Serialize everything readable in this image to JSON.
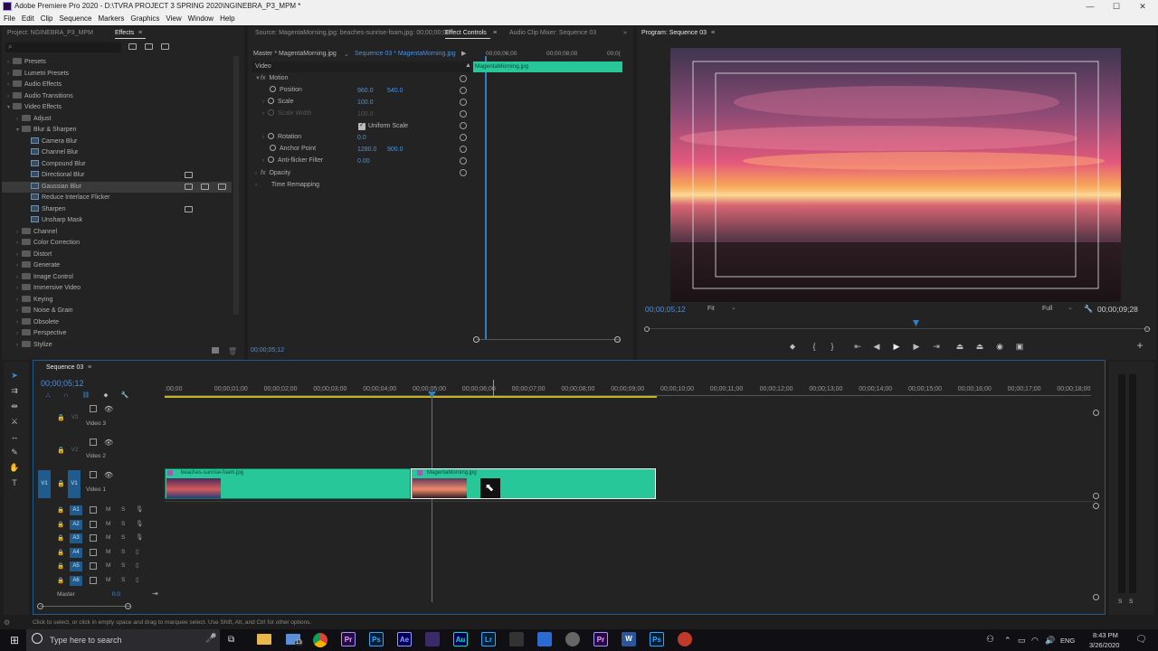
{
  "window": {
    "title": "Adobe Premiere Pro 2020 - D:\\TVRA PROJECT 3 SPRING 2020\\NGINEBRA_P3_MPM *",
    "minimize": "—",
    "maximize": "☐",
    "close": "✕"
  },
  "menu": [
    "File",
    "Edit",
    "Clip",
    "Sequence",
    "Markers",
    "Graphics",
    "View",
    "Window",
    "Help"
  ],
  "left_panel": {
    "tabs": [
      "Project: NGINEBRA_P3_MPM",
      "Effects"
    ],
    "search_placeholder": "",
    "tree": [
      {
        "label": "Presets",
        "level": 0,
        "type": "folder",
        "open": false
      },
      {
        "label": "Lumetri Presets",
        "level": 0,
        "type": "folder",
        "open": false
      },
      {
        "label": "Audio Effects",
        "level": 0,
        "type": "folder",
        "open": false
      },
      {
        "label": "Audio Transitions",
        "level": 0,
        "type": "folder",
        "open": false
      },
      {
        "label": "Video Effects",
        "level": 0,
        "type": "folder",
        "open": true
      },
      {
        "label": "Adjust",
        "level": 1,
        "type": "folder",
        "open": false
      },
      {
        "label": "Blur & Sharpen",
        "level": 1,
        "type": "folder",
        "open": true
      },
      {
        "label": "Camera Blur",
        "level": 2,
        "type": "fx"
      },
      {
        "label": "Channel Blur",
        "level": 2,
        "type": "fx"
      },
      {
        "label": "Compound Blur",
        "level": 2,
        "type": "fx"
      },
      {
        "label": "Directional Blur",
        "level": 2,
        "type": "fx"
      },
      {
        "label": "Gaussian Blur",
        "level": 2,
        "type": "fx",
        "selected": true
      },
      {
        "label": "Reduce Interlace Flicker",
        "level": 2,
        "type": "fx"
      },
      {
        "label": "Sharpen",
        "level": 2,
        "type": "fx"
      },
      {
        "label": "Unsharp Mask",
        "level": 2,
        "type": "fx"
      },
      {
        "label": "Channel",
        "level": 1,
        "type": "folder",
        "open": false
      },
      {
        "label": "Color Correction",
        "level": 1,
        "type": "folder",
        "open": false
      },
      {
        "label": "Distort",
        "level": 1,
        "type": "folder",
        "open": false
      },
      {
        "label": "Generate",
        "level": 1,
        "type": "folder",
        "open": false
      },
      {
        "label": "Image Control",
        "level": 1,
        "type": "folder",
        "open": false
      },
      {
        "label": "Immersive Video",
        "level": 1,
        "type": "folder",
        "open": false
      },
      {
        "label": "Keying",
        "level": 1,
        "type": "folder",
        "open": false
      },
      {
        "label": "Noise & Grain",
        "level": 1,
        "type": "folder",
        "open": false
      },
      {
        "label": "Obsolete",
        "level": 1,
        "type": "folder",
        "open": false
      },
      {
        "label": "Perspective",
        "level": 1,
        "type": "folder",
        "open": false
      },
      {
        "label": "Stylize",
        "level": 1,
        "type": "folder",
        "open": false
      }
    ]
  },
  "effect_controls": {
    "tabs": [
      "Source: MagentaMorning.jpg: beaches-sunrise-foam.jpg: 00;00;00;00",
      "Effect Controls",
      "Audio Clip Mixer: Sequence 03"
    ],
    "master_label": "Master * MagentaMorning.jpg",
    "seq_label": "Sequence 03 * MagentaMorning.jpg",
    "section_video": "Video",
    "motion": "Motion",
    "position_label": "Position",
    "position_x": "960.0",
    "position_y": "540.0",
    "scale_label": "Scale",
    "scale_value": "100.0",
    "scale_width_label": "Scale Width",
    "scale_width_value": "100.0",
    "uniform_scale": "Uniform Scale",
    "rotation_label": "Rotation",
    "rotation_value": "0.0",
    "anchor_label": "Anchor Point",
    "anchor_x": "1280.0",
    "anchor_y": "900.0",
    "antiflicker_label": "Anti-flicker Filter",
    "antiflicker_value": "0.00",
    "opacity": "Opacity",
    "time_remap": "Time Remapping",
    "timecode": "00;00;05;12",
    "mini_ruler": [
      "00;00;06;00",
      "00;00;08;00",
      "00;0("
    ],
    "clip_label": "MagentaMorning.jpg"
  },
  "program": {
    "tab": "Program: Sequence 03",
    "timecode": "00;00;05;12",
    "fit": "Fit",
    "full": "Full",
    "duration": "00;00;09;28"
  },
  "timeline": {
    "tab": "Sequence 03",
    "timecode": "00;00;05;12",
    "ruler": [
      ":00;00",
      "00;00;01;00",
      "00;00;02;00",
      "00;00;03;00",
      "00;00;04;00",
      "00;00;05;00",
      "00;00;06;00",
      "00;00;07;00",
      "00;00;08;00",
      "00;00;09;00",
      "00;00;10;00",
      "00;00;11;00",
      "00;00;12;00",
      "00;00;13;00",
      "00;00;14;00",
      "00;00;15;00",
      "00;00;16;00",
      "00;00;17;00",
      "00;00;18;00"
    ],
    "video_tracks": [
      {
        "id": "V3",
        "name": "Video 3"
      },
      {
        "id": "V2",
        "name": "Video 2"
      },
      {
        "id": "V1",
        "name": "Video 1",
        "src": "V1"
      }
    ],
    "audio_tracks": [
      "A1",
      "A2",
      "A3",
      "A4",
      "A5",
      "A6"
    ],
    "master_label": "Master",
    "master_value": "0.0",
    "clip1": "beaches-sunrise-foam.jpg",
    "clip2": "MagentaMorning.jpg",
    "m_label": "M",
    "s_label": "S"
  },
  "status_bar": "Click to select, or click in empty space and drag to marquee select. Use Shift, Alt, and Ctrl for other options.",
  "taskbar": {
    "search_placeholder": "Type here to search",
    "lang": "ENG",
    "time": "8:43 PM",
    "date": "3/26/2020",
    "mail_badge": "13",
    "apps": [
      "Pr",
      "Ps",
      "Ae",
      "Au",
      "Lr",
      "Pr",
      "W",
      "Ps"
    ]
  }
}
